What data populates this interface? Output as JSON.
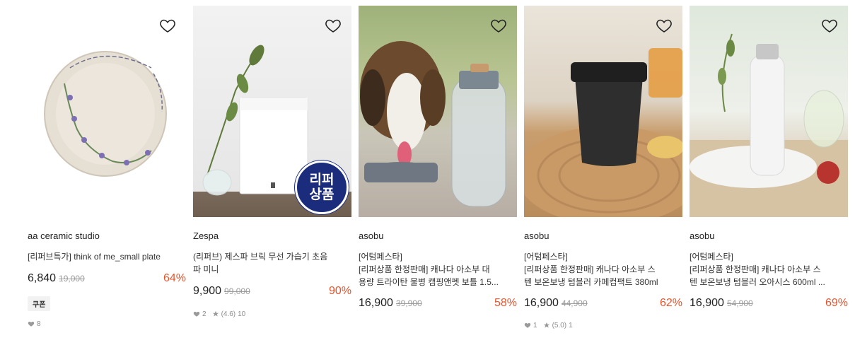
{
  "products": [
    {
      "brand": "aa ceramic studio",
      "title_prefix": "[리퍼브특가]",
      "title_line1": " think of me_small plate",
      "title_line2": "",
      "price": "6,840",
      "original_price": "19,000",
      "discount": "64%",
      "coupon_label": "쿠폰",
      "likes": "8",
      "rating": "",
      "reviews": ""
    },
    {
      "brand": "Zespa",
      "title_prefix": "",
      "title_line1": "(리퍼브) 제스파 브릭 무선 가습기 초음",
      "title_line2": "파 미니",
      "price": "9,900",
      "original_price": "99,000",
      "discount": "90%",
      "badge_line1": "리퍼",
      "badge_line2": "상품",
      "likes": "2",
      "rating": "(4.6)",
      "reviews": "10"
    },
    {
      "brand": "asobu",
      "title_prefix": "[어텀페스타]",
      "title_line1": "[리퍼상품 한정판매] 캐나다 아소부 대",
      "title_line2": "용량 트라이탄 물병 캠핑앤펫 보틀 1.5...",
      "price": "16,900",
      "original_price": "39,900",
      "discount": "58%"
    },
    {
      "brand": "asobu",
      "title_prefix": "[어텀페스타]",
      "title_line1": "[리퍼상품 한정판매] 캐나다 아소부 스",
      "title_line2": "텐 보온보냉 텀블러 카페컴팩트 380ml",
      "price": "16,900",
      "original_price": "44,900",
      "discount": "62%",
      "likes": "1",
      "rating": "(5.0)",
      "reviews": "1"
    },
    {
      "brand": "asobu",
      "title_prefix": "[어텀페스타]",
      "title_line1": "[리퍼상품 한정판매] 캐나다 아소부 스",
      "title_line2": "텐 보온보냉 텀블러 오아시스 600ml ...",
      "price": "16,900",
      "original_price": "54,900",
      "discount": "69%"
    }
  ],
  "colors": {
    "discount": "#e8542d",
    "badge": "#1c2c7c",
    "muted": "#9a9a9a"
  },
  "icons": {
    "wishlist": "heart-outline-icon",
    "like": "heart-filled-icon",
    "rating": "star-icon"
  }
}
